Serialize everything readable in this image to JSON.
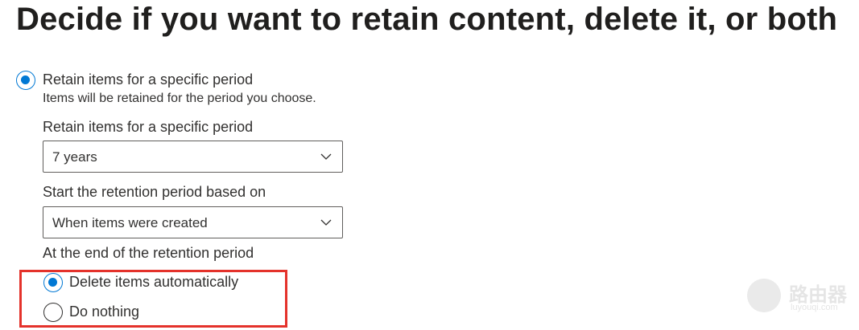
{
  "page": {
    "title": "Decide if you want to retain content, delete it, or both"
  },
  "retain_option": {
    "label": "Retain items for a specific period",
    "description": "Items will be retained for the period you choose.",
    "selected": true
  },
  "retention_period": {
    "label": "Retain items for a specific period",
    "value": "7 years"
  },
  "start_based_on": {
    "label": "Start the retention period based on",
    "value": "When items were created"
  },
  "end_of_period": {
    "label": "At the end of the retention period",
    "options": [
      {
        "label": "Delete items automatically",
        "selected": true
      },
      {
        "label": "Do nothing",
        "selected": false
      }
    ]
  },
  "colors": {
    "accent": "#0078d4",
    "highlight_border": "#e4322b",
    "text": "#323130"
  },
  "watermark": {
    "main": "路由器",
    "sub": "luyouqi.com"
  }
}
